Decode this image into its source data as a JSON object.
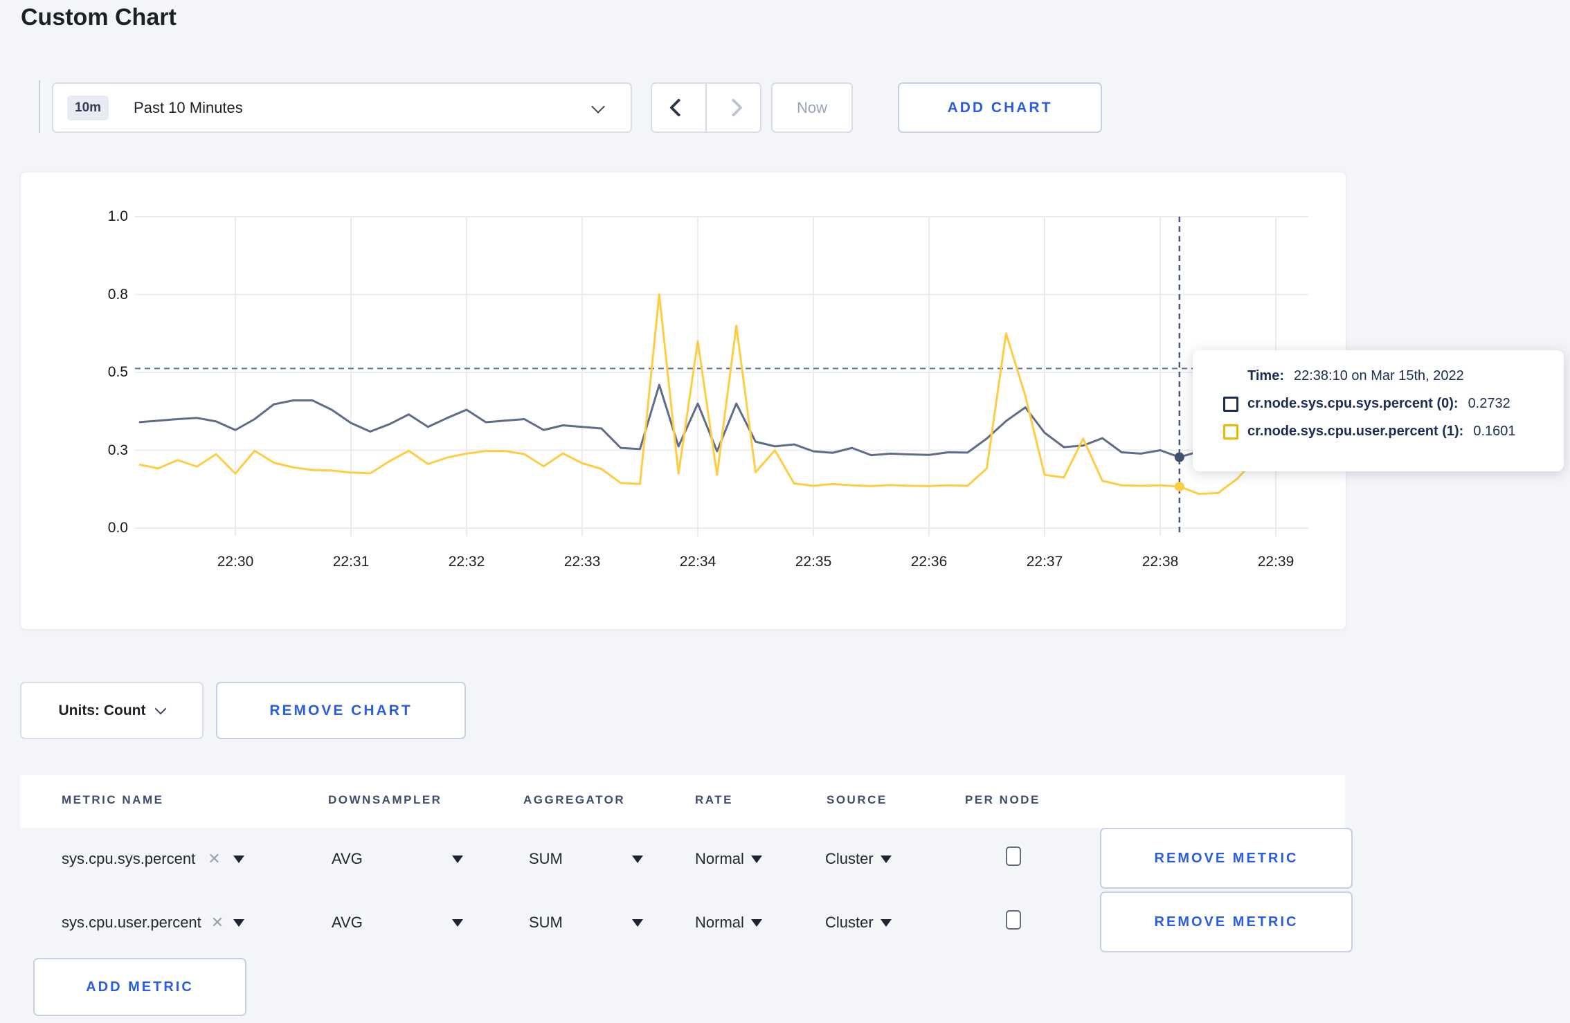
{
  "page": {
    "title": "Custom Chart",
    "bg": "#f4f5f9",
    "accent_blue": "#2b5ddf"
  },
  "toolbar": {
    "range_badge": "10m",
    "range_label": "Past 10 Minutes",
    "prev_arrow": "chevron-left",
    "next_arrow": "chevron-right",
    "now_label": "Now",
    "add_chart_label": "ADD CHART"
  },
  "chart_data": {
    "type": "line",
    "title": "",
    "xlabel": "",
    "ylabel": "",
    "x_tick_labels": [
      "22:30",
      "22:31",
      "22:32",
      "22:33",
      "22:34",
      "22:35",
      "22:36",
      "22:37",
      "22:38",
      "22:39"
    ],
    "y_tick_labels": [
      "0.0",
      "0.3",
      "0.5",
      "0.8",
      "1.0"
    ],
    "y_tick_values": [
      0,
      0.3,
      0.5,
      0.8,
      1.0
    ],
    "grid": true,
    "x_start_time": "22:29:10",
    "x_step_seconds": 10,
    "series": [
      {
        "name": "cr.node.sys.cpu.sys.percent",
        "color": "#5f6c87",
        "values": [
          0.372,
          0.376,
          0.38,
          0.383,
          0.374,
          0.352,
          0.38,
          0.418,
          0.428,
          0.428,
          0.404,
          0.37,
          0.348,
          0.367,
          0.392,
          0.36,
          0.383,
          0.404,
          0.372,
          0.376,
          0.38,
          0.352,
          0.364,
          0.36,
          0.356,
          0.306,
          0.303,
          0.468,
          0.31,
          0.42,
          0.296,
          0.42,
          0.322,
          0.31,
          0.315,
          0.296,
          0.29,
          0.306,
          0.281,
          0.287,
          0.284,
          0.282,
          0.292,
          0.291,
          0.33,
          0.375,
          0.41,
          0.345,
          0.308,
          0.312,
          0.331,
          0.292,
          0.287,
          0.3,
          0.2732,
          0.295,
          0.3,
          0.302,
          0.298,
          0.3,
          0.3
        ]
      },
      {
        "name": "cr.node.sys.cpu.user.percent",
        "color": "#ffcd44",
        "values": [
          0.245,
          0.23,
          0.262,
          0.237,
          0.285,
          0.21,
          0.298,
          0.252,
          0.234,
          0.224,
          0.222,
          0.214,
          0.211,
          0.258,
          0.298,
          0.247,
          0.272,
          0.287,
          0.297,
          0.297,
          0.285,
          0.238,
          0.288,
          0.25,
          0.228,
          0.174,
          0.17,
          0.8,
          0.21,
          0.62,
          0.205,
          0.68,
          0.215,
          0.3,
          0.172,
          0.163,
          0.17,
          0.165,
          0.162,
          0.166,
          0.163,
          0.162,
          0.165,
          0.163,
          0.23,
          0.65,
          0.44,
          0.205,
          0.195,
          0.33,
          0.182,
          0.165,
          0.163,
          0.165,
          0.1601,
          0.132,
          0.135,
          0.19,
          0.27,
          0.282,
          0.238
        ]
      }
    ],
    "crosshair": {
      "x_index": 54,
      "time": "22:38:10",
      "dashed_horizontal_value": 0.515
    }
  },
  "tooltip": {
    "time_label": "Time:",
    "time_value": "22:38:10 on Mar 15th, 2022",
    "series": [
      {
        "label": "cr.node.sys.cpu.sys.percent (0):",
        "value": "0.2732",
        "swatch_color": "#1d2c52"
      },
      {
        "label": "cr.node.sys.cpu.user.percent (1):",
        "value": "0.1601",
        "swatch_color": "#f5b301"
      }
    ]
  },
  "units": {
    "label": "Units: Count",
    "remove_chart_label": "REMOVE CHART"
  },
  "table": {
    "headers": [
      "METRIC NAME",
      "DOWNSAMPLER",
      "AGGREGATOR",
      "RATE",
      "SOURCE",
      "PER NODE"
    ],
    "rows": [
      {
        "metric_name": "sys.cpu.sys.percent",
        "downsampler": "AVG",
        "aggregator": "SUM",
        "rate": "Normal",
        "source": "Cluster",
        "per_node_checked": false,
        "remove_label": "REMOVE METRIC"
      },
      {
        "metric_name": "sys.cpu.user.percent",
        "downsampler": "AVG",
        "aggregator": "SUM",
        "rate": "Normal",
        "source": "Cluster",
        "per_node_checked": false,
        "remove_label": "REMOVE METRIC"
      }
    ],
    "add_metric_label": "ADD METRIC"
  }
}
